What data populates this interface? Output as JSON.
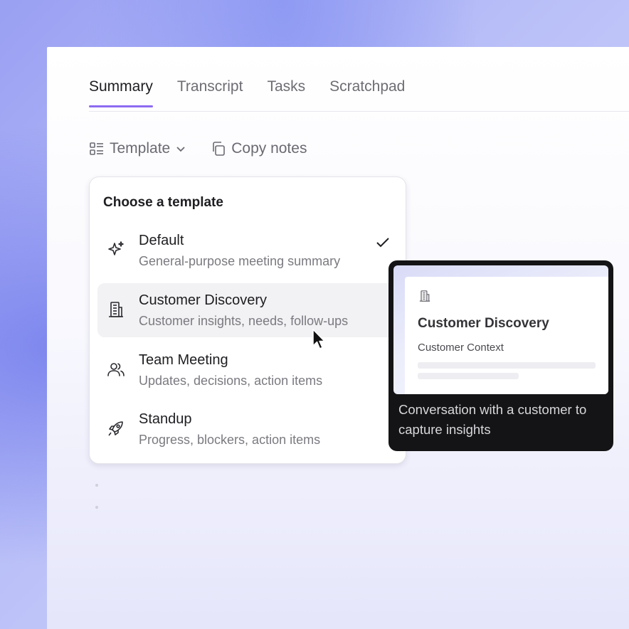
{
  "tabs": [
    {
      "label": "Summary",
      "active": true
    },
    {
      "label": "Transcript",
      "active": false
    },
    {
      "label": "Tasks",
      "active": false
    },
    {
      "label": "Scratchpad",
      "active": false
    }
  ],
  "toolbar": {
    "template_label": "Template",
    "template_icon": "list-layout-icon",
    "copy_label": "Copy notes",
    "copy_icon": "copy-icon"
  },
  "template_menu": {
    "title": "Choose a template",
    "items": [
      {
        "name": "Default",
        "description": "General-purpose meeting summary",
        "icon": "sparkles-icon",
        "selected": true
      },
      {
        "name": "Customer Discovery",
        "description": "Customer insights, needs, follow-ups",
        "icon": "building-icon",
        "hovered": true
      },
      {
        "name": "Team Meeting",
        "description": "Updates, decisions, action items",
        "icon": "users-icon"
      },
      {
        "name": "Standup",
        "description": "Progress, blockers, action items",
        "icon": "rocket-icon"
      }
    ]
  },
  "preview_tooltip": {
    "card_icon": "building-icon",
    "card_title": "Customer Discovery",
    "card_section": "Customer Context",
    "description": "Conversation with a customer to capture insights"
  },
  "colors": {
    "accent": "#8c6bf0",
    "tooltip_bg": "#141416",
    "hover_bg": "#f2f2f4"
  }
}
